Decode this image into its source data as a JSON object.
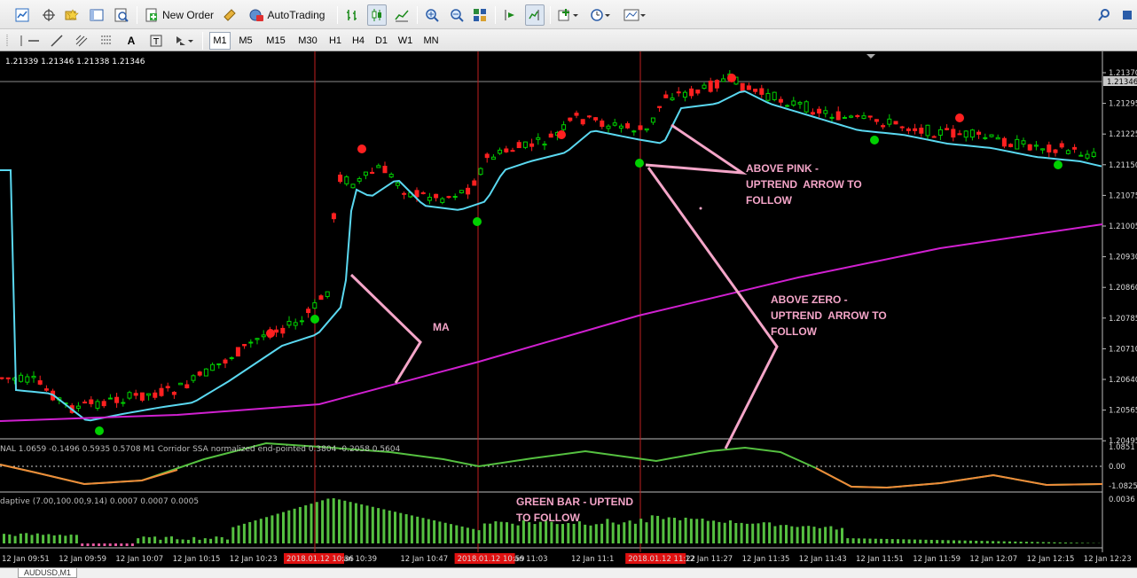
{
  "toolbar": {
    "new_order_label": "New Order",
    "autotrading_label": "AutoTrading"
  },
  "timeframes": [
    "M1",
    "M5",
    "M15",
    "M30",
    "H1",
    "H4",
    "D1",
    "W1",
    "MN"
  ],
  "active_timeframe": "M1",
  "chart": {
    "ohlc_text": "1.21339 1.21346 1.21338 1.21346",
    "current_price": "1.21346",
    "price_axis": [
      "1.21370",
      "1.21295",
      "1.21225",
      "1.21150",
      "1.21075",
      "1.21005",
      "1.20930",
      "1.20860",
      "1.20785",
      "1.20710",
      "1.20640",
      "1.20565",
      "1.20495"
    ],
    "osc_axis": [
      "1.0851",
      "0.00",
      "-1.0825"
    ],
    "hist_axis": [
      "0.0036"
    ],
    "time_axis": [
      "12 Jan 09:51",
      "12 Jan 09:59",
      "12 Jan 10:07",
      "12 Jan 10:15",
      "12 Jan 10:23",
      "2018.01.12 10:36",
      "an 10:39",
      "12 Jan 10:47",
      "2018.01.12 10:59",
      "an 11:03",
      "12 Jan 11:1",
      "2018.01.12 11:22",
      "12 Jan 11:27",
      "12 Jan 11:35",
      "12 Jan 11:43",
      "12 Jan 11:51",
      "12 Jan 11:59",
      "12 Jan 12:07",
      "12 Jan 12:15",
      "12 Jan 12:23"
    ],
    "osc_label": "NAL 1.0659 -0.1496 0.5935 0.5708  M1 Corridor SSA normalized end-pointed 0.3804 -0.2058 0.5604",
    "hist_label": "daptive (7.00,100.00,9.14) 0.0007 0.0007 0.0005",
    "colors": {
      "bull": "#00d000",
      "bear": "#ff2020",
      "ma_fast": "#5ad8f0",
      "ma_slow": "#d020d0",
      "osc_up": "#55c040",
      "osc_down": "#f08a3a",
      "annotation": "#f4a5c8",
      "vline": "#c02020"
    }
  },
  "annotations": {
    "ma": "MA",
    "above_pink": "ABOVE PINK -\nUPTREND  ARROW TO\nFOLLOW",
    "above_zero": "ABOVE ZERO -\nUPTREND  ARROW TO\nFOLLOW",
    "green_bar": "GREEN BAR - UPTEND\nTO FOLLOW"
  },
  "statusbar": {
    "tab_label": "AUDUSD,M1"
  }
}
